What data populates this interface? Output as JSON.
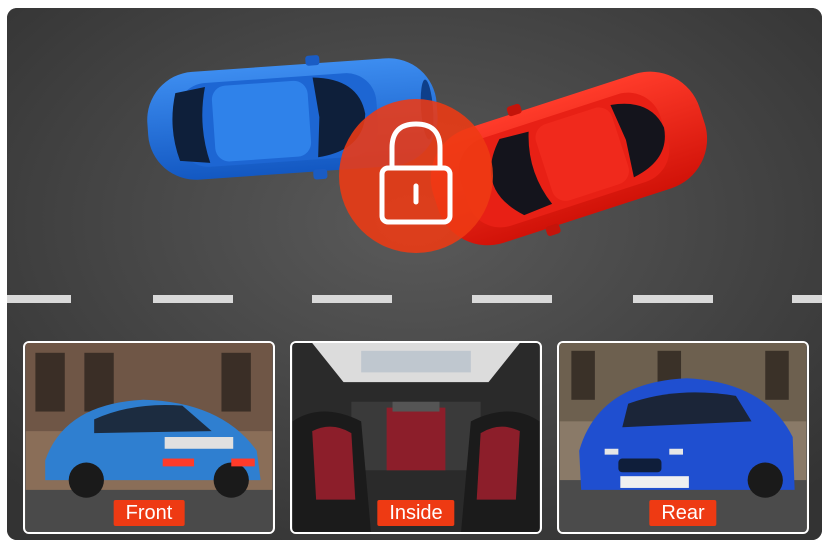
{
  "scene": {
    "lock_icon": "padlock-icon",
    "accent_color": "#ee3a13",
    "road_color": "#3e3e3e",
    "vehicles": [
      {
        "name": "blue-car",
        "color": "#1e6fd6"
      },
      {
        "name": "red-car",
        "color": "#e01a12"
      }
    ]
  },
  "cameras": [
    {
      "label": "Front",
      "icon": "car-rear-view-image"
    },
    {
      "label": "Inside",
      "icon": "car-interior-image"
    },
    {
      "label": "Rear",
      "icon": "car-front-view-image"
    }
  ]
}
